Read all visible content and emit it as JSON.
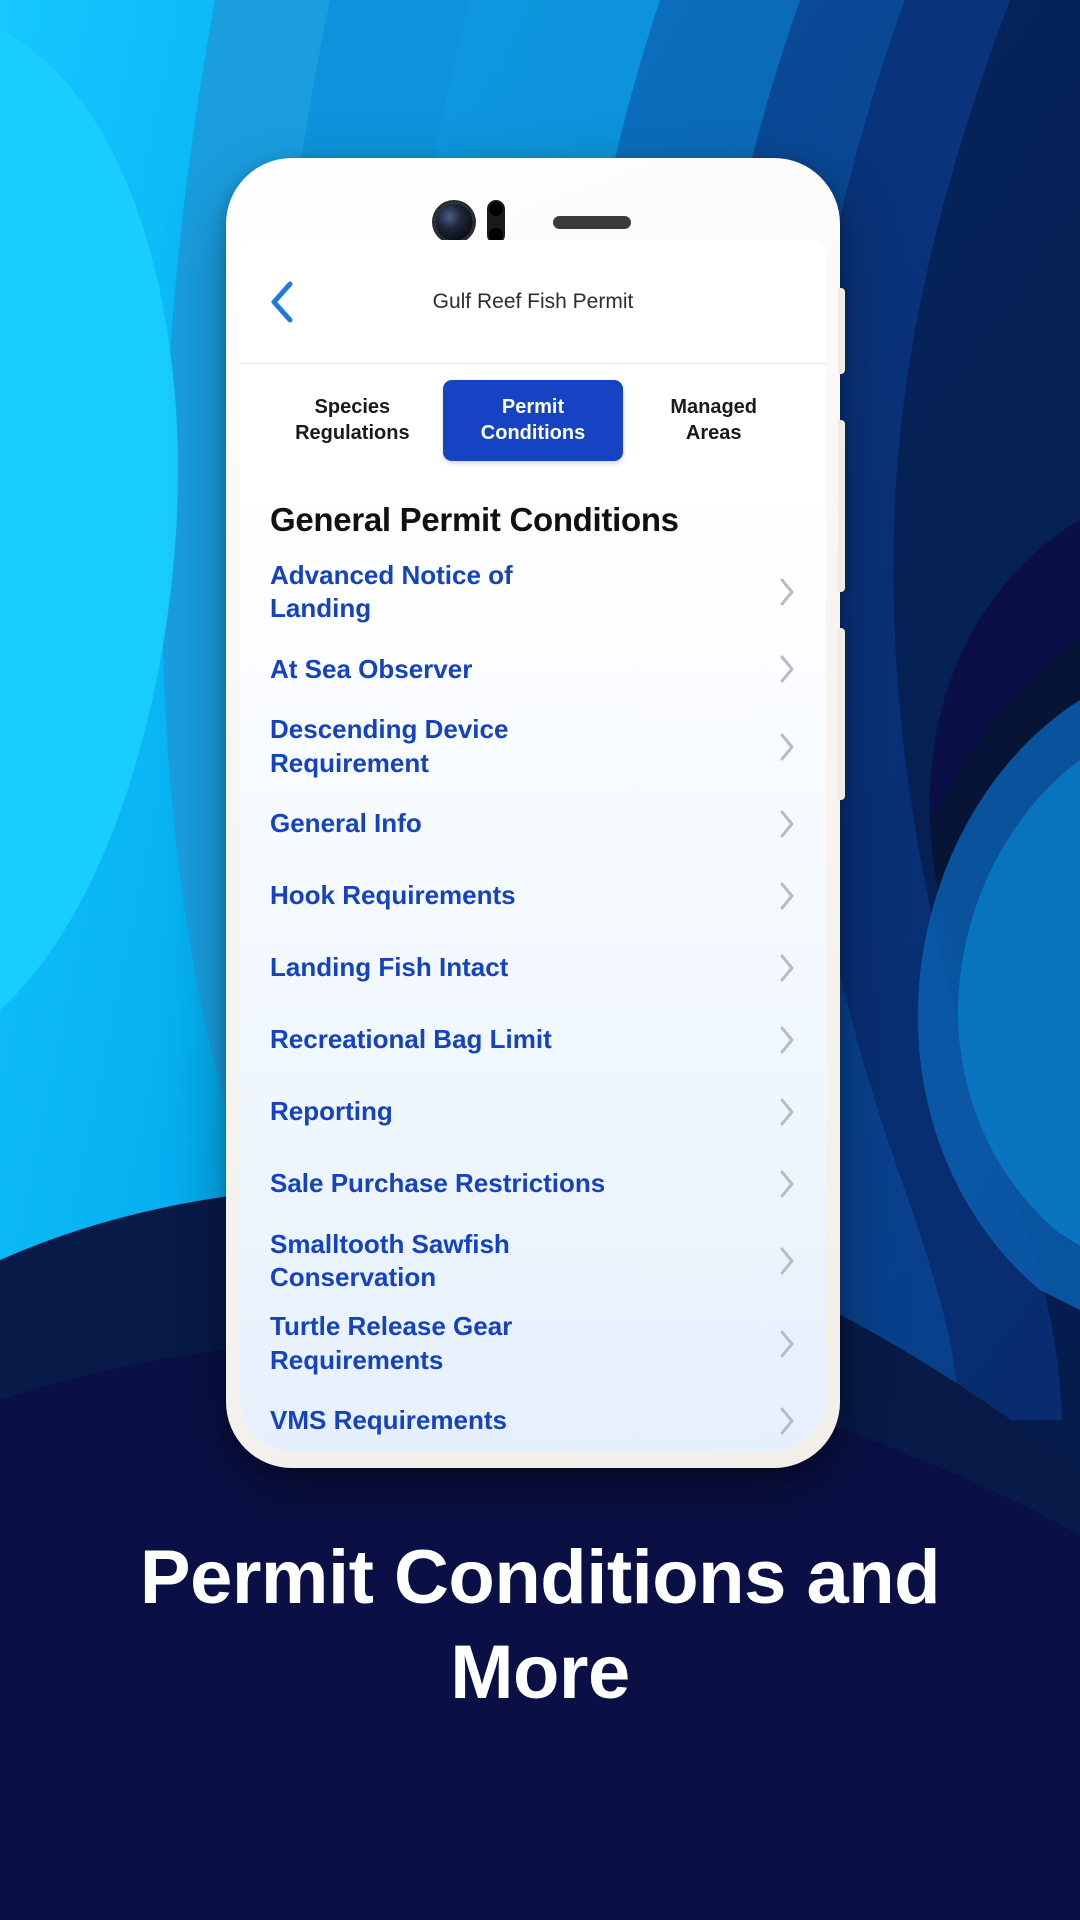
{
  "caption": "Permit Conditions and More",
  "colors": {
    "accent_active_tab": "#1543c4",
    "link_blue": "#1442c0",
    "back_arrow_blue": "#1f7ae0",
    "page_navy": "#0a1045",
    "wave_cyan": "#00bcf5",
    "wave_light_blue": "#0d93dc",
    "wave_mid_blue": "#0b6fc0",
    "wave_deep_blue": "#0b4f9e",
    "wave_dark_blue": "#0a3a86",
    "wave_navy": "#072b6b",
    "chevron_gray": "#b9bcc0"
  },
  "phone": {
    "hardware": {
      "camera": "camera-lens",
      "sensor": "proximity-sensor",
      "speaker": "earpiece-speaker",
      "side_buttons": [
        "volume-up",
        "volume-down",
        "power"
      ]
    }
  },
  "app": {
    "navbar": {
      "back_icon": "chevron-left-icon",
      "title": "Gulf Reef Fish Permit"
    },
    "tabs": [
      {
        "label": "Species\nRegulations",
        "active": false
      },
      {
        "label": "Permit\nConditions",
        "active": true
      },
      {
        "label": "Managed\nAreas",
        "active": false
      }
    ],
    "section_title": "General Permit Conditions",
    "list_items": [
      {
        "label": "Advanced Notice of\nLanding",
        "chevron": "chevron-right-icon"
      },
      {
        "label": "At Sea Observer",
        "chevron": "chevron-right-icon"
      },
      {
        "label": "Descending Device\nRequirement",
        "chevron": "chevron-right-icon"
      },
      {
        "label": "General Info",
        "chevron": "chevron-right-icon"
      },
      {
        "label": "Hook Requirements",
        "chevron": "chevron-right-icon"
      },
      {
        "label": "Landing Fish Intact",
        "chevron": "chevron-right-icon"
      },
      {
        "label": "Recreational Bag Limit",
        "chevron": "chevron-right-icon"
      },
      {
        "label": "Reporting",
        "chevron": "chevron-right-icon"
      },
      {
        "label": "Sale Purchase Restrictions",
        "chevron": "chevron-right-icon"
      },
      {
        "label": "Smalltooth Sawfish\nConservation",
        "chevron": "chevron-right-icon"
      },
      {
        "label": "Turtle Release Gear\nRequirements",
        "chevron": "chevron-right-icon"
      },
      {
        "label": "VMS Requirements",
        "chevron": "chevron-right-icon"
      }
    ]
  }
}
